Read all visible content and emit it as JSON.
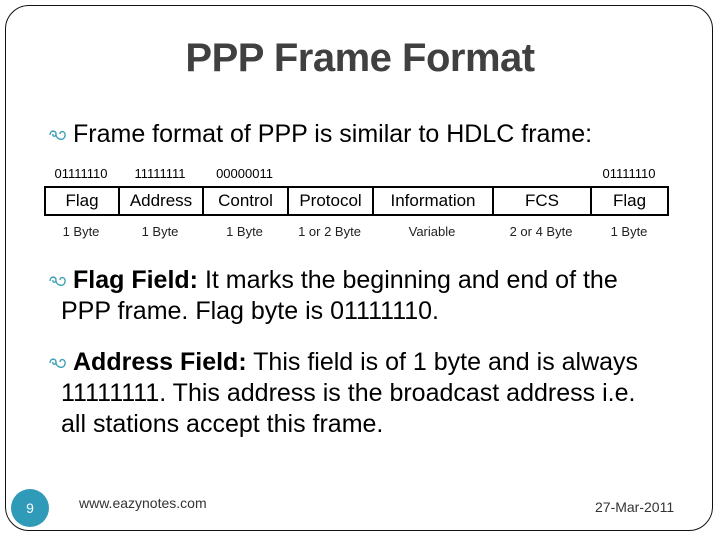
{
  "slide": {
    "title": "PPP Frame Format",
    "page_number": "9",
    "footer_site": "www.eazynotes.com",
    "footer_date": "27-Mar-2011",
    "accent_color": "#2f9bb8",
    "bullet_icon": "curl-bullet-icon"
  },
  "intro": {
    "text": "Frame format of PPP is similar to HDLC frame:"
  },
  "frame": {
    "fields": [
      {
        "name": "Flag",
        "bits": "01111110",
        "size": "1 Byte"
      },
      {
        "name": "Address",
        "bits": "11111111",
        "size": "1 Byte"
      },
      {
        "name": "Control",
        "bits": "00000011",
        "size": "1 Byte"
      },
      {
        "name": "Protocol",
        "bits": "",
        "size": "1 or 2 Byte"
      },
      {
        "name": "Information",
        "bits": "",
        "size": "Variable"
      },
      {
        "name": "FCS",
        "bits": "",
        "size": "2 or 4 Byte"
      },
      {
        "name": "Flag",
        "bits": "01111110",
        "size": "1 Byte"
      }
    ]
  },
  "bullets": [
    {
      "label": "Flag Field:",
      "line1": " It marks the beginning and end of the",
      "line2": "PPP frame. Flag byte is 01111110."
    },
    {
      "label": "Address Field:",
      "line1": " This field is of 1 byte and is always",
      "line2": "11111111. This address is the broadcast address i.e.",
      "line3": "all stations accept this frame."
    }
  ]
}
